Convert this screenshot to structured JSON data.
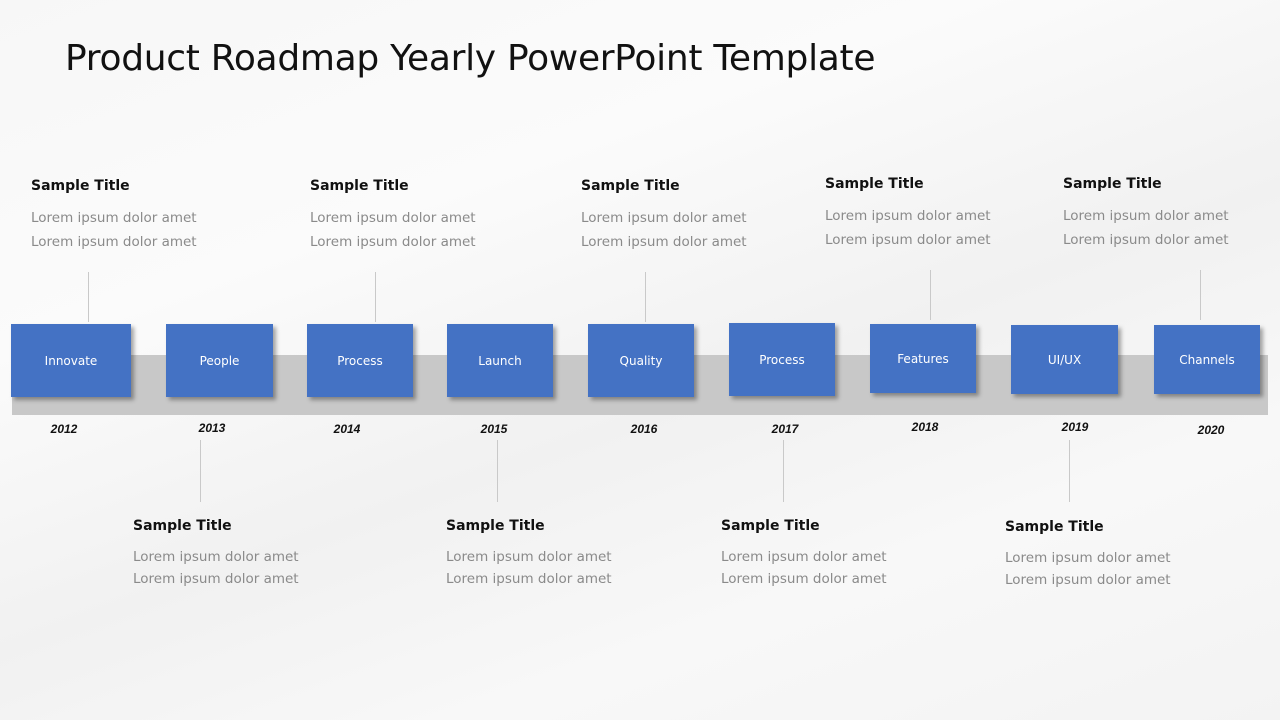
{
  "slide": {
    "title": "Product Roadmap Yearly PowerPoint Template"
  },
  "colors": {
    "box": "#4472c4",
    "band": "#c8c8c8"
  },
  "milestones": [
    {
      "label": "Innovate",
      "year": "2012"
    },
    {
      "label": "People",
      "year": "2013"
    },
    {
      "label": "Process",
      "year": "2014"
    },
    {
      "label": "Launch",
      "year": "2015"
    },
    {
      "label": "Quality",
      "year": "2016"
    },
    {
      "label": "Process",
      "year": "2017"
    },
    {
      "label": "Features",
      "year": "2018"
    },
    {
      "label": "UI/UX",
      "year": "2019"
    },
    {
      "label": "Channels",
      "year": "2020"
    }
  ],
  "notes_top": [
    {
      "title": "Sample Title",
      "line1": "Lorem ipsum dolor amet",
      "line2": "Lorem ipsum dolor amet"
    },
    {
      "title": "Sample Title",
      "line1": "Lorem ipsum dolor amet",
      "line2": "Lorem ipsum dolor amet"
    },
    {
      "title": "Sample Title",
      "line1": "Lorem ipsum dolor amet",
      "line2": "Lorem ipsum dolor amet"
    },
    {
      "title": "Sample Title",
      "line1": "Lorem ipsum dolor amet",
      "line2": "Lorem ipsum dolor amet"
    },
    {
      "title": "Sample Title",
      "line1": "Lorem ipsum dolor amet",
      "line2": "Lorem ipsum dolor amet"
    }
  ],
  "notes_bottom": [
    {
      "title": "Sample Title",
      "line1": "Lorem ipsum dolor amet",
      "line2": "Lorem ipsum dolor amet"
    },
    {
      "title": "Sample Title",
      "line1": "Lorem ipsum dolor amet",
      "line2": "Lorem ipsum dolor amet"
    },
    {
      "title": "Sample Title",
      "line1": "Lorem ipsum dolor amet",
      "line2": "Lorem ipsum dolor amet"
    },
    {
      "title": "Sample Title",
      "line1": "Lorem ipsum dolor amet",
      "line2": "Lorem ipsum dolor amet"
    }
  ]
}
